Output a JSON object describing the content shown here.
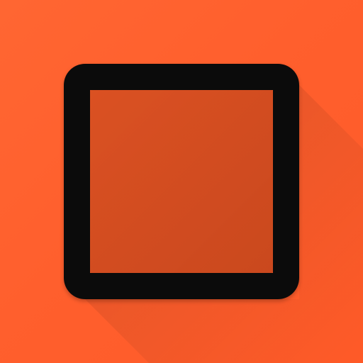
{
  "icon": {
    "name": "stop-square-icon",
    "background_color": "#FF5E2B",
    "outline_color": "#0B0B0B"
  }
}
